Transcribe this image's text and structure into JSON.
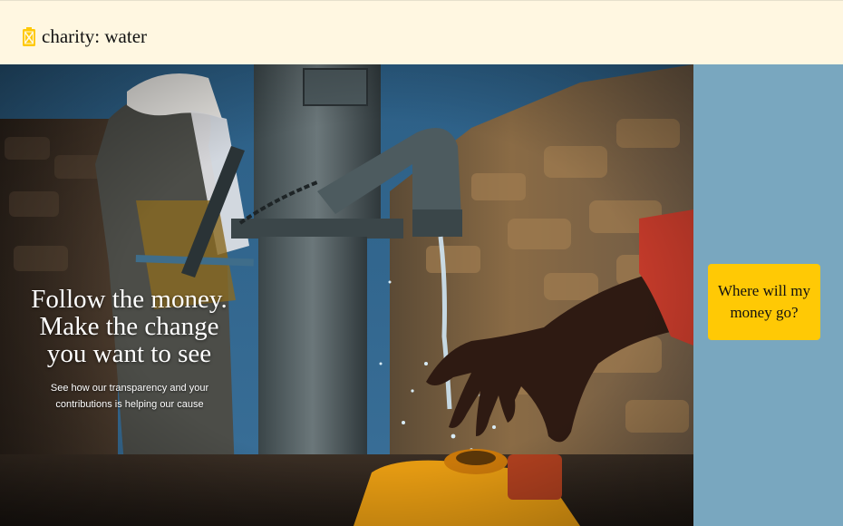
{
  "header": {
    "logo_text": "charity: water",
    "logo_icon": "jerrycan-icon",
    "background": "#fff7e1"
  },
  "hero": {
    "headline_line1": "Follow the money.",
    "headline_line2": "Make the change",
    "headline_line3": "you want to see",
    "subtext_line1": "See how our transparency and your",
    "subtext_line2": "contributions is helping our cause",
    "image": "hand-pump-water-photo"
  },
  "side_panel": {
    "background": "#79a7bf",
    "cta_line1": "Where will my",
    "cta_line2": "money go?",
    "cta_color": "#ffc905"
  }
}
